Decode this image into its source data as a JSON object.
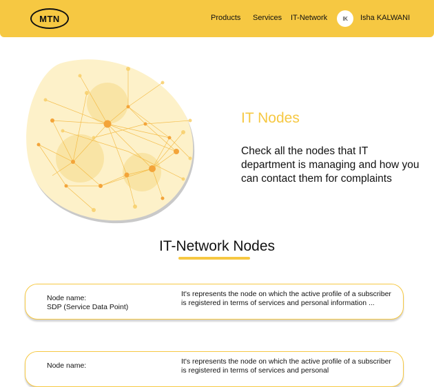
{
  "header": {
    "logo_text": "MTN",
    "nav": [
      {
        "label": "Products"
      },
      {
        "label": "Services"
      },
      {
        "label": "IT-Network"
      }
    ],
    "user": {
      "initials": "IK",
      "name": "Isha KALWANI"
    },
    "brand_color": "#f6c842"
  },
  "hero": {
    "title": "IT Nodes",
    "description": "Check all the nodes that IT department is managing and how you can contact them for complaints"
  },
  "section": {
    "title": "IT-Network Nodes"
  },
  "nodes": [
    {
      "label": "Node name:",
      "name": "SDP (Service  Data Point)",
      "description": "It's represents the node on which the active profile of a subscriber is registered in terms of services and personal information ..."
    },
    {
      "label": "Node name:",
      "name": "",
      "description": "It's represents the node on which the active profile of a subscriber is registered in terms of services and personal"
    }
  ]
}
